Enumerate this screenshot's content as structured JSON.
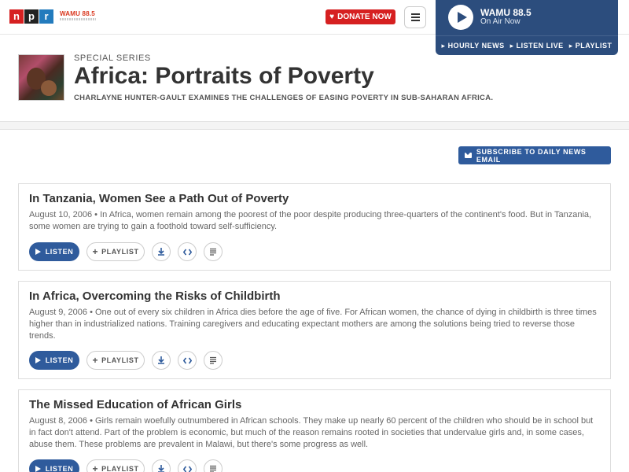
{
  "header": {
    "npr_logo": [
      "n",
      "p",
      "r"
    ],
    "station_logo": "WAMU 88.5",
    "donate_label": "DONATE NOW"
  },
  "player": {
    "station": "WAMU 88.5",
    "status": "On Air Now",
    "links": [
      "HOURLY NEWS",
      "LISTEN LIVE",
      "PLAYLIST"
    ]
  },
  "series": {
    "kicker": "Special Series",
    "title": "Africa: Portraits of Poverty",
    "description": "Charlayne Hunter-Gault examines the challenges of easing poverty in sub-Saharan Africa."
  },
  "subscribe_label": "SUBSCRIBE TO DAILY NEWS EMAIL",
  "stories": [
    {
      "title": "In Tanzania, Women See a Path Out of Poverty",
      "date": "August 10, 2006",
      "teaser": "In Africa, women remain among the poorest of the poor despite producing three-quarters of the continent's food. But in Tanzania, some women are trying to gain a foothold toward self-sufficiency."
    },
    {
      "title": "In Africa, Overcoming the Risks of Childbirth",
      "date": "August 9, 2006",
      "teaser": "One out of every six children in Africa dies before the age of five. For African women, the chance of dying in childbirth is three times higher than in industrialized nations. Training caregivers and educating expectant mothers are among the solutions being tried to reverse those trends."
    },
    {
      "title": "The Missed Education of African Girls",
      "date": "August 8, 2006",
      "teaser": "Girls remain woefully outnumbered in African schools. They make up nearly 60 percent of the children who should be in school but in fact don't attend. Part of the problem is economic, but much of the reason remains rooted in societies that undervalue girls and, in some cases, abuse them. These problems are prevalent in Malawi, but there's some progress as well."
    }
  ],
  "actions": {
    "listen_label": "LISTEN",
    "playlist_label": "PLAYLIST",
    "icons": [
      "download-icon",
      "embed-icon",
      "transcript-icon"
    ]
  },
  "colors": {
    "npr_red": "#d62021",
    "player_blue": "#2c4d7d",
    "button_blue": "#2f5b9c"
  }
}
